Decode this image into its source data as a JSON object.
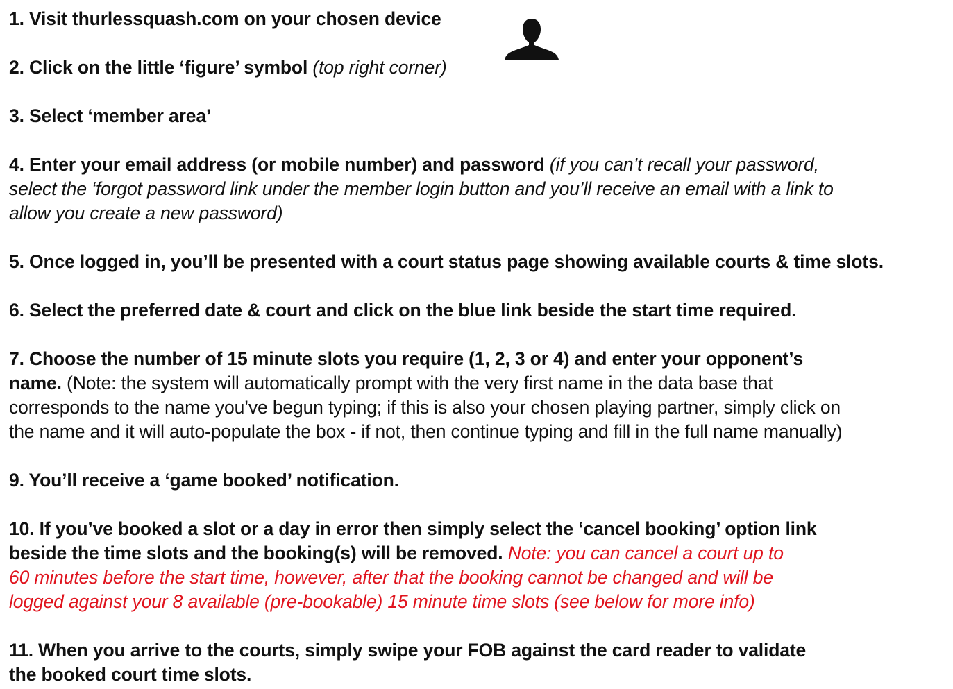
{
  "icon": {
    "name": "person-figure-icon",
    "color": "#111111"
  },
  "colors": {
    "text": "#111111",
    "note_red": "#e0141e",
    "background": "#ffffff"
  },
  "steps": [
    {
      "lines": [
        [
          {
            "text": "1. Visit thurlessquash.com on your chosen device"
          }
        ]
      ]
    },
    {
      "lines": [
        [
          {
            "text": "2. Click on the little ‘figure’ symbol "
          },
          {
            "text": "(top right corner)",
            "style": "it"
          }
        ]
      ]
    },
    {
      "lines": [
        [
          {
            "text": "3. Select ‘member area’"
          }
        ]
      ]
    },
    {
      "lines": [
        [
          {
            "text": "4. Enter your email address (or mobile number) and password "
          },
          {
            "text": "(if you can’t recall your password,",
            "style": "it"
          }
        ],
        [
          {
            "text": "select the ‘forgot password link under the member login button and you’ll receive an email with a link to",
            "style": "it"
          }
        ],
        [
          {
            "text": "allow you create a new password)",
            "style": "it"
          }
        ]
      ]
    },
    {
      "lines": [
        [
          {
            "text": "5. Once logged in, you’ll be presented with a court status page showing available courts & time slots."
          }
        ]
      ]
    },
    {
      "lines": [
        [
          {
            "text": "6. Select the preferred date & court and click on the blue link beside the start time required."
          }
        ]
      ]
    },
    {
      "lines": [
        [
          {
            "text": "7. Choose the number of 15 minute slots you require (1, 2, 3 or 4) and enter your opponent’s"
          }
        ],
        [
          {
            "text": "name."
          },
          {
            "text": " (Note: the system will automatically prompt with the very first name in the data base that",
            "style": "normal"
          }
        ],
        [
          {
            "text": "corresponds to the name you’ve begun typing; if this is also your chosen playing partner, simply click on",
            "style": "normal"
          }
        ],
        [
          {
            "text": "the name and it will auto-populate the box - if not, then continue typing and fill in the full name manually)",
            "style": "normal"
          }
        ]
      ]
    },
    {
      "lines": [
        [
          {
            "text": "9. You’ll receive a ‘game booked’ notification."
          }
        ]
      ]
    },
    {
      "lines": [
        [
          {
            "text": "10. If you’ve booked a slot or a day in error then simply select the ‘cancel booking’ option link"
          }
        ],
        [
          {
            "text": "beside the time slots and the booking(s) will be removed. "
          },
          {
            "text": "Note: you can cancel a court up to",
            "style": "red"
          }
        ],
        [
          {
            "text": "60 minutes before the start time, however, after that the booking cannot be changed and will be",
            "style": "red"
          }
        ],
        [
          {
            "text": "logged against your 8 available (pre-bookable) 15 minute time slots (see below for more info)",
            "style": "red"
          }
        ]
      ]
    },
    {
      "lines": [
        [
          {
            "text": "11. When you arrive to the courts, simply swipe your FOB against the card reader to validate"
          }
        ],
        [
          {
            "text": "the booked court time slots."
          }
        ]
      ]
    }
  ]
}
